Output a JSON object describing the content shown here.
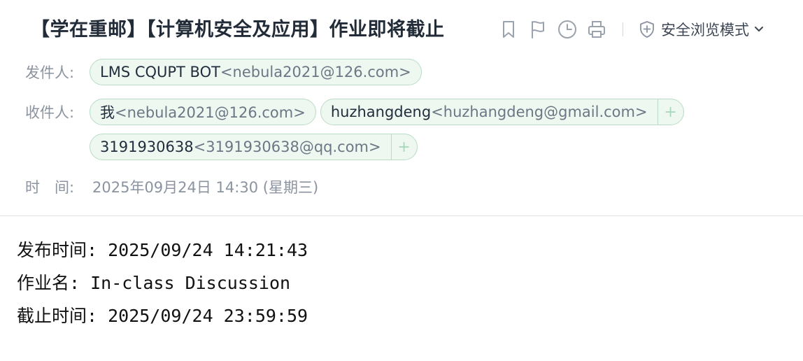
{
  "email": {
    "subject": "【学在重邮】【计算机安全及应用】作业即将截止",
    "toolbar": {
      "icons": [
        "bookmark-icon",
        "flag-icon",
        "clock-icon",
        "print-icon"
      ],
      "safe_mode_label": "安全浏览模式"
    },
    "from": {
      "label": "发件人:",
      "name": "LMS CQUPT BOT",
      "email": "<nebula2021@126.com>"
    },
    "to": {
      "label": "收件人:",
      "recipients": [
        {
          "name": "我",
          "email": "<nebula2021@126.com>",
          "plus": ""
        },
        {
          "name": "huzhangdeng",
          "email": "<huzhangdeng@gmail.com>",
          "plus": "+"
        },
        {
          "name": "3191930638",
          "email": "<3191930638@qq.com>",
          "plus": "+"
        }
      ]
    },
    "time": {
      "label": "时　间:",
      "value": "2025年09月24日 14:30 (星期三)"
    },
    "body_lines": [
      "发布时间: 2025/09/24 14:21:43",
      "作业名: In-class Discussion",
      "截止时间: 2025/09/24 23:59:59"
    ]
  },
  "colors": {
    "chip_border": "#b8dcc5",
    "chip_bg": "#eef8f1",
    "label": "#8a939f",
    "text": "#1f2d3d"
  }
}
